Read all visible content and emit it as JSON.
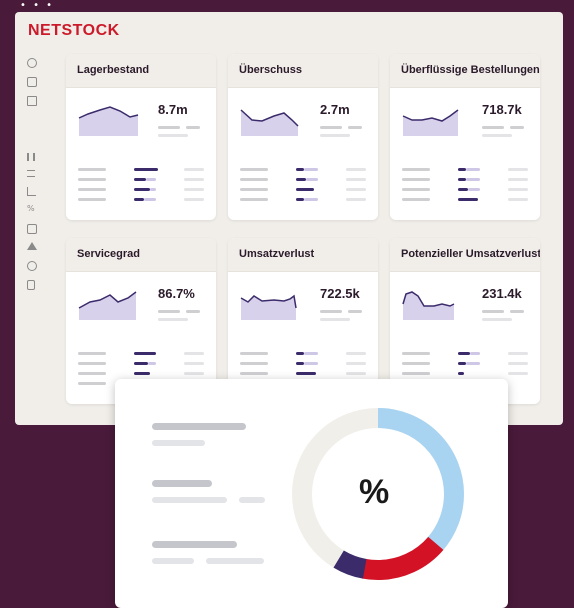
{
  "app": {
    "brand": "NETSTOCK",
    "window_dots": "• • •"
  },
  "sidebar": {
    "icons": [
      "circle-icon",
      "square-icon",
      "folder-icon",
      "columns-icon",
      "list-icon",
      "chart-icon",
      "percent-icon",
      "box-icon",
      "triangle-icon",
      "circle-icon",
      "lock-icon"
    ]
  },
  "cards": [
    {
      "title": "Lagerbestand",
      "value": "8.7m"
    },
    {
      "title": "Überschuss",
      "value": "2.7m"
    },
    {
      "title": "Überflüssige Bestellungen",
      "value": "718.7k"
    },
    {
      "title": "Servicegrad",
      "value": "86.7%"
    },
    {
      "title": "Umsatzverlust",
      "value": "722.5k"
    },
    {
      "title": "Potenzieller Umsatzverlust",
      "value": "231.4k"
    }
  ],
  "overlay": {
    "center_label": "%",
    "donut_colors": {
      "blue": "#a8d4f2",
      "red": "#d41226",
      "purple": "#3b2b6b",
      "rest": "#f1efea"
    }
  }
}
